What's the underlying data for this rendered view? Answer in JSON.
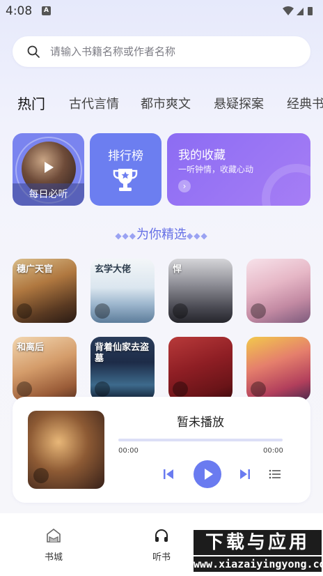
{
  "status_bar": {
    "time": "4:08",
    "notif_badge": "A"
  },
  "search": {
    "placeholder": "请输入书籍名称或作者名称"
  },
  "tabs": [
    {
      "label": "热门",
      "active": true
    },
    {
      "label": "古代言情"
    },
    {
      "label": "都市爽文"
    },
    {
      "label": "悬疑探案"
    },
    {
      "label": "经典书"
    }
  ],
  "cards": {
    "daily": {
      "label": "每日必听"
    },
    "rank": {
      "label": "排行榜"
    },
    "fav": {
      "title": "我的收藏",
      "subtitle": "一听钟情，收藏心动"
    }
  },
  "section": {
    "title": "为你精选",
    "deco_left": "◆◆◆",
    "deco_right": "◆◆◆"
  },
  "covers": [
    {
      "title": "穗广天官",
      "style": "dark-red"
    },
    {
      "title": "玄学大佬",
      "style": "light-blue"
    },
    {
      "title": "悍",
      "style": "grey"
    },
    {
      "title": "",
      "style": "pink"
    },
    {
      "title": "和离后",
      "style": "warm"
    },
    {
      "title": "背着仙家去盗墓",
      "style": "navy"
    },
    {
      "title": "",
      "style": "crimson"
    },
    {
      "title": "",
      "style": "colorful"
    }
  ],
  "player": {
    "status": "暂未播放",
    "time_start": "00:00",
    "time_end": "00:00",
    "progress": 0
  },
  "bottom_nav": [
    {
      "label": "书城"
    },
    {
      "label": "听书"
    }
  ],
  "watermark": {
    "big": "下载与应用",
    "small": "www.xiazaiyingyong.com"
  },
  "colors": {
    "accent": "#6a7bf0",
    "fav_card": "#9470f4"
  }
}
